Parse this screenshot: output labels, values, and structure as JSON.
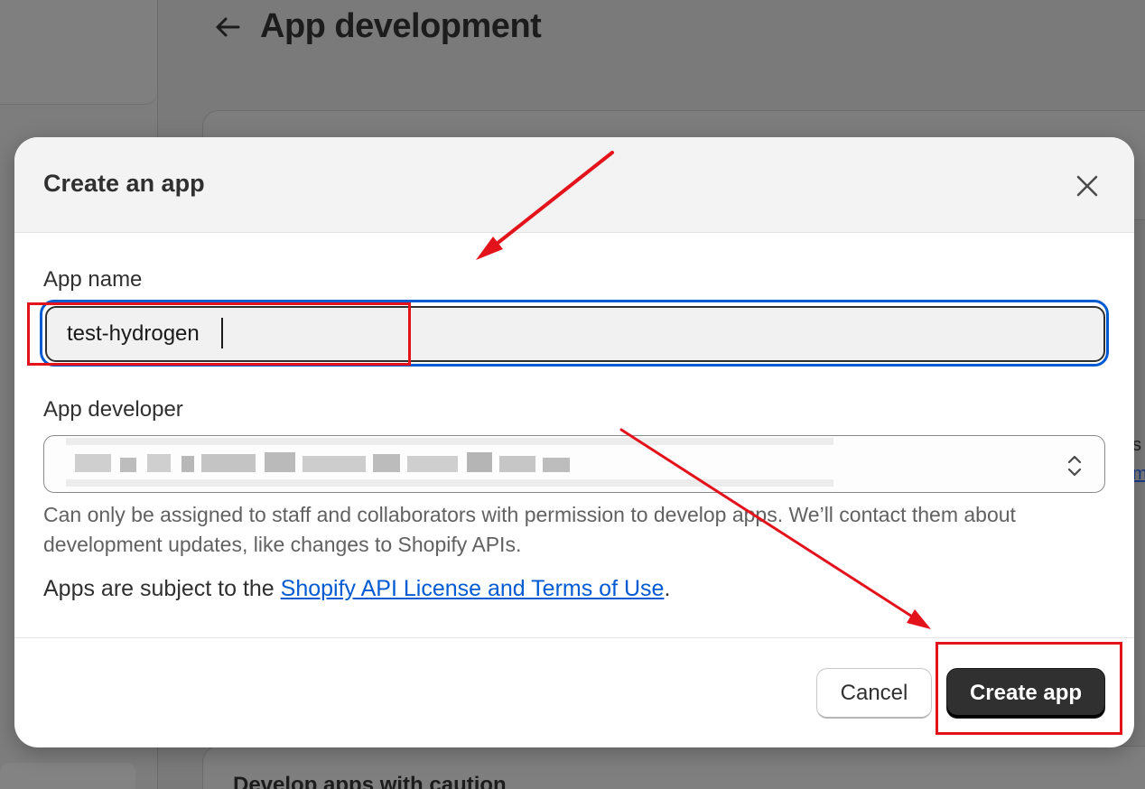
{
  "background": {
    "page_title": "App development",
    "edge_text": "s",
    "edge_link_text": "m",
    "lower_card_title": "Develop apps with caution"
  },
  "modal": {
    "title": "Create an app",
    "app_name": {
      "label": "App name",
      "value": "test-hydrogen"
    },
    "app_developer": {
      "label": "App developer",
      "selected_value_redacted": true
    },
    "help_text": "Can only be assigned to staff and collaborators with permission to develop apps. We’ll contact them about development updates, like changes to Shopify APIs.",
    "terms": {
      "prefix": "Apps are subject to the ",
      "link_text": "Shopify API License and Terms of Use",
      "suffix": "."
    },
    "buttons": {
      "cancel": "Cancel",
      "create": "Create app"
    }
  },
  "colors": {
    "overlay_dim": "#7a7a7a",
    "primary_button": "#303030",
    "focus_ring": "#005bd3",
    "link": "#005bd3",
    "annotation": "#e3131b"
  },
  "icons": {
    "back": "arrow-left-icon",
    "close": "close-icon",
    "select": "chevron-up-down-icon"
  }
}
